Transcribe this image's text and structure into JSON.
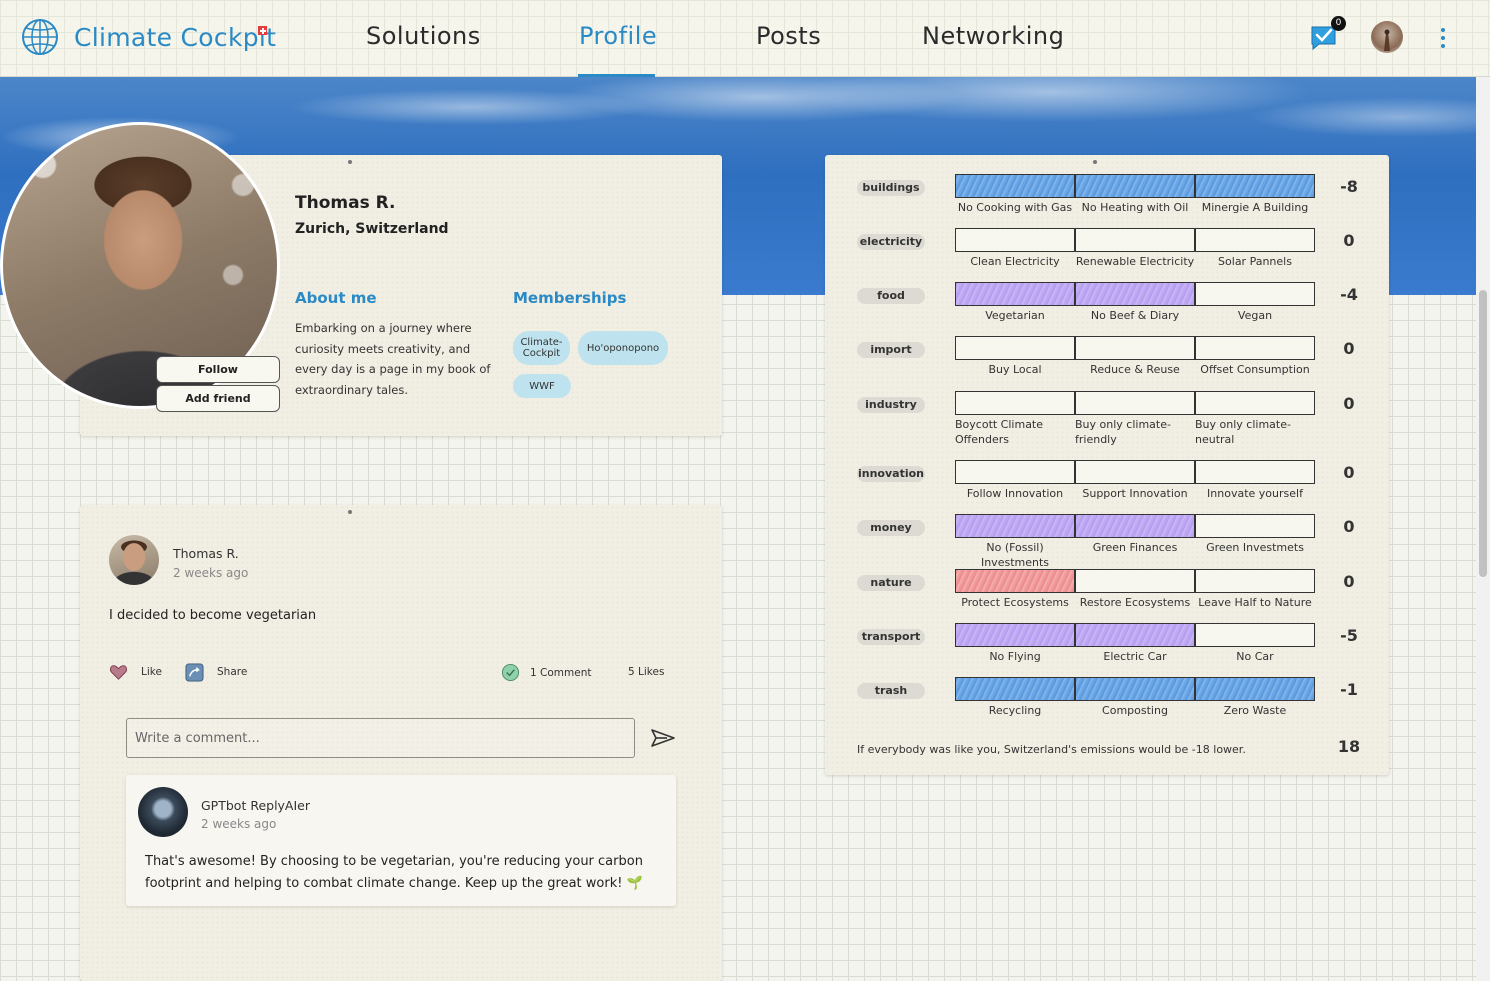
{
  "header": {
    "app_name": "Climate Cockpit",
    "nav": [
      "Solutions",
      "Profile",
      "Posts",
      "Networking"
    ],
    "active_nav": "Profile",
    "notification_count": "0",
    "accent_color": "#2a8ac5"
  },
  "profile": {
    "name": "Thomas R.",
    "location": "Zurich, Switzerland",
    "follow_label": "Follow",
    "add_friend_label": "Add friend",
    "about_title": "About me",
    "about_text": "Embarking on a journey where curiosity meets creativity, and every day is a page in my book of extraordinary tales.",
    "memberships_title": "Memberships",
    "memberships": [
      "Climate-Cockpit",
      "Ho'oponopono",
      "WWF"
    ]
  },
  "post": {
    "author": "Thomas R.",
    "time": "2 weeks ago",
    "text": "I decided to become vegetarian",
    "like_label": "Like",
    "share_label": "Share",
    "comments_label": "1 Comment",
    "likes_label": "5 Likes",
    "comment_placeholder": "Write a comment...",
    "reply": {
      "author": "GPTbot ReplyAIer",
      "time": "2 weeks ago",
      "text": "That's awesome! By choosing to be vegetarian, you're reducing your carbon footprint and helping to combat climate change. Keep up the great work! 🌱"
    }
  },
  "footprint": {
    "rows": [
      {
        "category": "buildings",
        "score": "-8",
        "options": [
          {
            "label": "No Cooking with Gas",
            "color": "blue"
          },
          {
            "label": "No Heating with Oil",
            "color": "blue"
          },
          {
            "label": "Minergie A Building",
            "color": "blue"
          }
        ]
      },
      {
        "category": "electricity",
        "score": "0",
        "options": [
          {
            "label": "Clean Electricity",
            "color": "none"
          },
          {
            "label": "Renewable Electricity",
            "color": "none"
          },
          {
            "label": "Solar Pannels",
            "color": "none"
          }
        ]
      },
      {
        "category": "food",
        "score": "-4",
        "options": [
          {
            "label": "Vegetarian",
            "color": "purple"
          },
          {
            "label": "No Beef & Diary",
            "color": "purple"
          },
          {
            "label": "Vegan",
            "color": "none"
          }
        ]
      },
      {
        "category": "import",
        "score": "0",
        "options": [
          {
            "label": "Buy Local",
            "color": "none"
          },
          {
            "label": "Reduce & Reuse",
            "color": "none"
          },
          {
            "label": "Offset Consumption",
            "color": "none"
          }
        ]
      },
      {
        "category": "industry",
        "score": "0",
        "options": [
          {
            "label": "Boycott Climate Offenders",
            "color": "none"
          },
          {
            "label": "Buy only climate-friendly",
            "color": "none"
          },
          {
            "label": "Buy only climate-neutral",
            "color": "none"
          }
        ]
      },
      {
        "category": "innovation",
        "score": "0",
        "options": [
          {
            "label": "Follow Innovation",
            "color": "none"
          },
          {
            "label": "Support Innovation",
            "color": "none"
          },
          {
            "label": "Innovate yourself",
            "color": "none"
          }
        ]
      },
      {
        "category": "money",
        "score": "0",
        "options": [
          {
            "label": "No (Fossil) Investments",
            "color": "purple"
          },
          {
            "label": "Green Finances",
            "color": "purple"
          },
          {
            "label": "Green Investmets",
            "color": "none"
          }
        ]
      },
      {
        "category": "nature",
        "score": "0",
        "options": [
          {
            "label": "Protect Ecosystems",
            "color": "red"
          },
          {
            "label": "Restore Ecosystems",
            "color": "none"
          },
          {
            "label": "Leave Half to Nature",
            "color": "none"
          }
        ]
      },
      {
        "category": "transport",
        "score": "-5",
        "options": [
          {
            "label": "No Flying",
            "color": "purple"
          },
          {
            "label": "Electric Car",
            "color": "purple"
          },
          {
            "label": "No Car",
            "color": "none"
          }
        ]
      },
      {
        "category": "trash",
        "score": "-1",
        "options": [
          {
            "label": "Recycling",
            "color": "blue"
          },
          {
            "label": "Composting",
            "color": "blue"
          },
          {
            "label": "Zero Waste",
            "color": "blue"
          }
        ]
      }
    ],
    "summary": "If everybody was like you, Switzerland's emissions would be -18 lower.",
    "total": "18"
  }
}
